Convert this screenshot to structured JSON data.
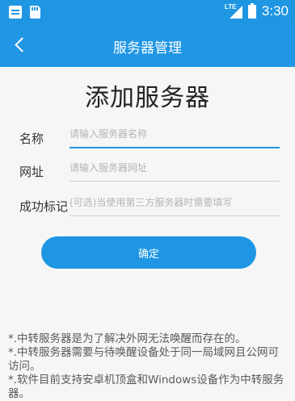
{
  "status_bar": {
    "network": "LTE",
    "time": "3:30"
  },
  "app_bar": {
    "title": "服务器管理"
  },
  "heading": "添加服务器",
  "form": {
    "name": {
      "label": "名称",
      "placeholder": "请输入服务器名称",
      "value": ""
    },
    "url": {
      "label": "网址",
      "placeholder": "请输入服务器网址",
      "value": ""
    },
    "mark": {
      "label": "成功标记",
      "placeholder": "(可选)当使用第三方服务器时需要填写",
      "value": ""
    }
  },
  "confirm_label": "确定",
  "notes": [
    "*.中转服务器是为了解决外网无法唤醒而存在的。",
    "*.中转服务器需要与待唤醒设备处于同一局域网且公网可访问。",
    "*.软件目前支持安卓机顶盒和Windows设备作为中转服务器。"
  ]
}
